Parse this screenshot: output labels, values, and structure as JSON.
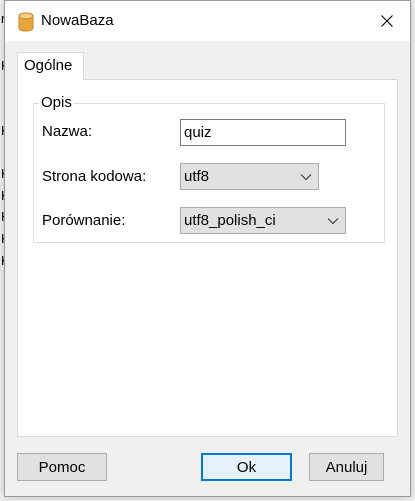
{
  "dialog": {
    "title": "NowaBaza",
    "tab": {
      "label": "Ogólne"
    },
    "group": {
      "title": "Opis",
      "name_label": "Nazwa:",
      "name_value": "quiz",
      "codepage_label": "Strona kodowa:",
      "codepage_value": "utf8",
      "collation_label": "Porównanie:",
      "collation_value": "utf8_polish_ci"
    },
    "buttons": {
      "help": "Pomoc",
      "ok": "Ok",
      "cancel": "Anuluj"
    }
  },
  "background": {
    "fragments": [
      "n",
      "K",
      "K",
      "K",
      "K",
      "K",
      "K",
      "K"
    ]
  },
  "colors": {
    "accent": "#0078d7",
    "db_icon": "#e8a63a"
  }
}
